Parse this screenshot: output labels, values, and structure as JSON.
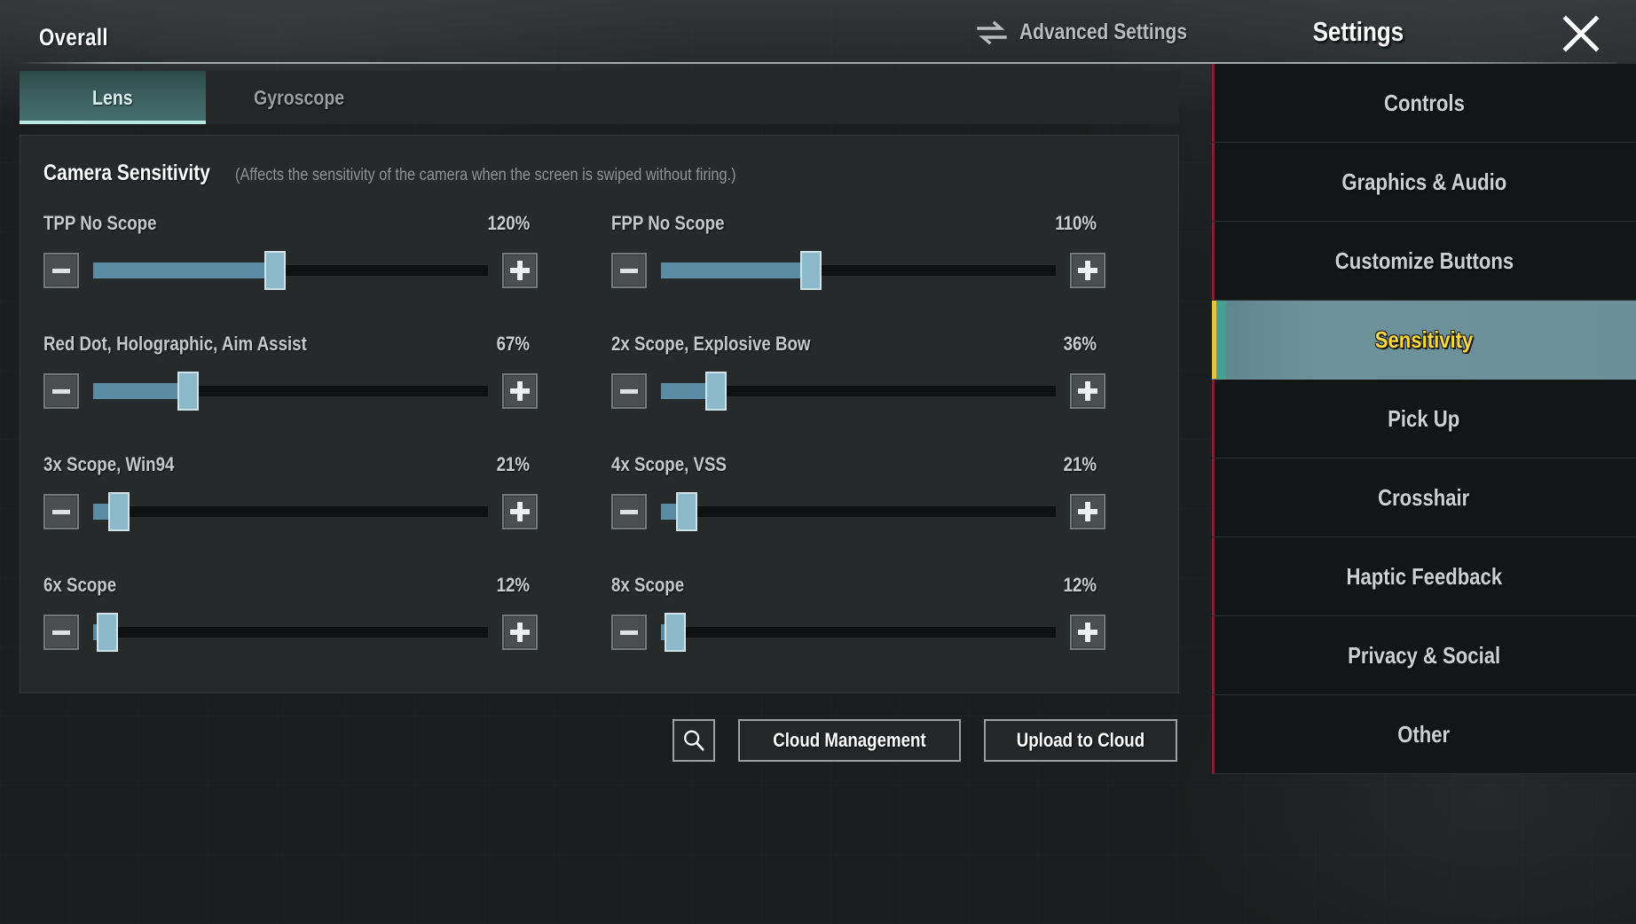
{
  "header": {
    "overall_label": "Overall",
    "advanced_settings_label": "Advanced Settings",
    "advanced_settings_icon": "swap-arrows-icon",
    "settings_title": "Settings",
    "close_icon": "close-icon"
  },
  "tabs": [
    {
      "label": "Lens",
      "active": true
    },
    {
      "label": "Gyroscope",
      "active": false
    }
  ],
  "section": {
    "title": "Camera Sensitivity",
    "description": "(Affects the sensitivity of the camera when the screen is swiped without firing.)"
  },
  "sliders": [
    {
      "label": "TPP No Scope",
      "value": "120%",
      "percent": 46,
      "dec_icon": "minus-icon",
      "inc_icon": "plus-icon"
    },
    {
      "label": "FPP No Scope",
      "value": "110%",
      "percent": 36,
      "dec_icon": "minus-icon",
      "inc_icon": "plus-icon"
    },
    {
      "label": "Red Dot, Holographic, Aim Assist",
      "value": "67%",
      "percent": 24,
      "dec_icon": "minus-icon",
      "inc_icon": "plus-icon"
    },
    {
      "label": "2x Scope, Explosive Bow",
      "value": "36%",
      "percent": 14,
      "dec_icon": "minus-icon",
      "inc_icon": "plus-icon"
    },
    {
      "label": "3x Scope, Win94",
      "value": "21%",
      "percent": 7,
      "dec_icon": "minus-icon",
      "inc_icon": "plus-icon"
    },
    {
      "label": "4x Scope, VSS",
      "value": "21%",
      "percent": 7,
      "dec_icon": "minus-icon",
      "inc_icon": "plus-icon"
    },
    {
      "label": "6x Scope",
      "value": "12%",
      "percent": 4,
      "dec_icon": "minus-icon",
      "inc_icon": "plus-icon"
    },
    {
      "label": "8x Scope",
      "value": "12%",
      "percent": 4,
      "dec_icon": "minus-icon",
      "inc_icon": "plus-icon"
    }
  ],
  "footer": {
    "search_icon": "search-icon",
    "cloud_management_label": "Cloud Management",
    "upload_to_cloud_label": "Upload to Cloud"
  },
  "sidebar": {
    "items": [
      {
        "label": "Controls",
        "active": false
      },
      {
        "label": "Graphics & Audio",
        "active": false
      },
      {
        "label": "Customize Buttons",
        "active": false
      },
      {
        "label": "Sensitivity",
        "active": true
      },
      {
        "label": "Pick Up",
        "active": false
      },
      {
        "label": "Crosshair",
        "active": false
      },
      {
        "label": "Haptic Feedback",
        "active": false
      },
      {
        "label": "Privacy & Social",
        "active": false
      },
      {
        "label": "Other",
        "active": false
      }
    ]
  },
  "colors": {
    "accent_teal": "#46a091",
    "accent_yellow": "#ffd83a",
    "slider_fill": "#5b8ca3",
    "slider_knob": "#8cb9c9",
    "panel_bg": "#292c2d",
    "sidebar_bg": "#131516"
  }
}
